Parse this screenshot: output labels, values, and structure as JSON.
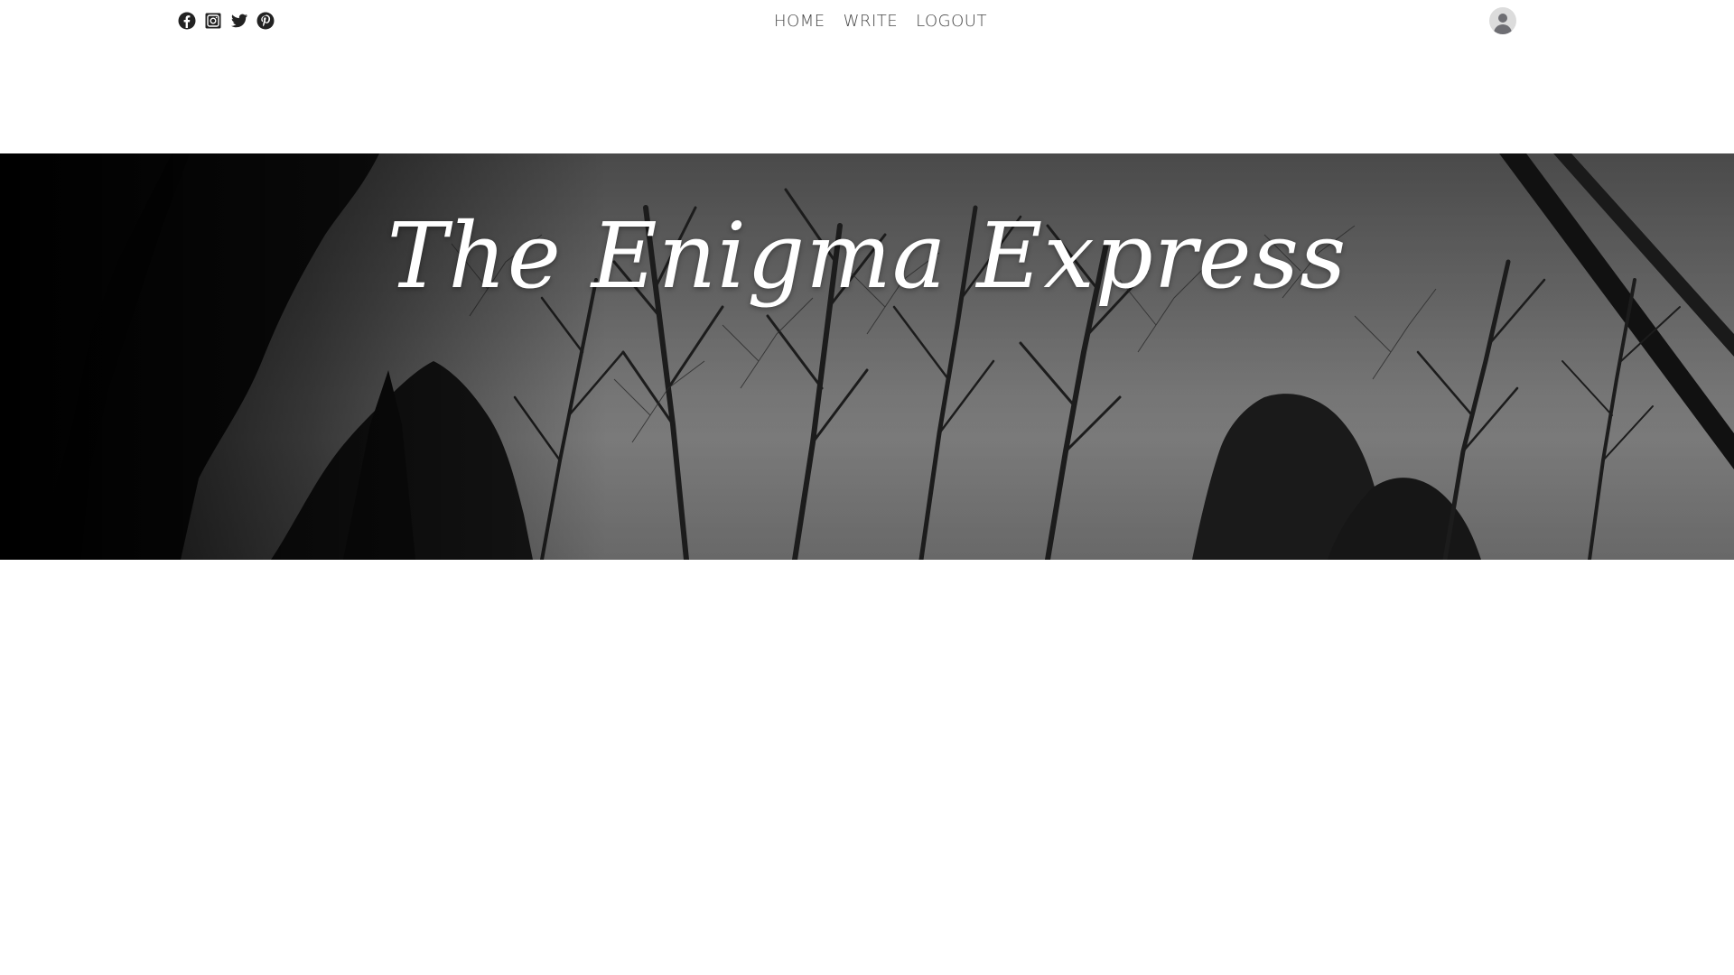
{
  "social": {
    "icons": [
      "facebook-icon",
      "instagram-icon",
      "twitter-icon",
      "pinterest-icon"
    ]
  },
  "nav": {
    "items": [
      {
        "label": "HOME"
      },
      {
        "label": "WRITE"
      },
      {
        "label": "LOGOUT"
      }
    ]
  },
  "user": {
    "avatar_icon": "user-avatar-icon"
  },
  "hero": {
    "title": "The Enigma Express"
  },
  "colors": {
    "nav_text": "#444444",
    "icon": "#222222",
    "hero_text": "#ffffff"
  }
}
